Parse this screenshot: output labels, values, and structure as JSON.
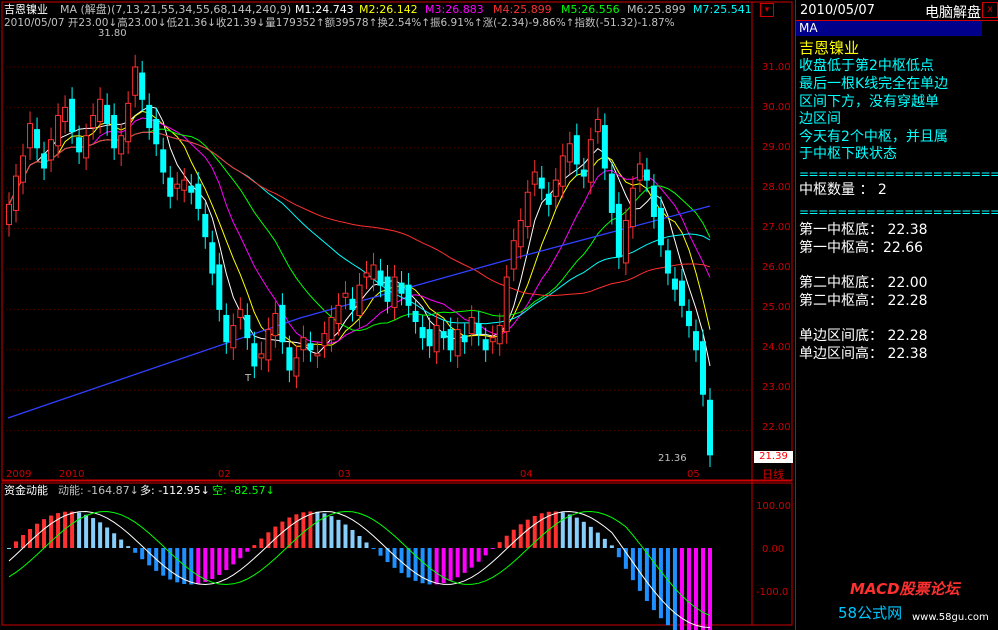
{
  "header": {
    "stock_name": "吉恩镍业",
    "ma_label": "MA (解盘)(7,13,21,55,34,55,68,144,240,9)",
    "m1": "M1:24.743",
    "m2": "M2:26.142",
    "m3": "M3:26.883",
    "m4": "M4:25.899",
    "m5": "M5:26.556",
    "m6": "M6:25.899",
    "m7": "M7:25.541",
    "quote": "2010/05/07 开23.00↓高23.00↓低21.36↓收21.39↓量179352↑额39578↑换2.54%↑振6.91%↑涨(-2.34)-9.86%↑指数(-51.32)-1.87%"
  },
  "price_axis": [
    "31.00",
    "30.00",
    "29.00",
    "28.00",
    "27.00",
    "26.00",
    "25.00",
    "24.00",
    "23.00",
    "22.00"
  ],
  "annotations": {
    "high": "31.80",
    "low": "21.36",
    "t_mark": "T"
  },
  "current_price": "21.39",
  "date_axis": [
    "2009",
    "2010",
    "02",
    "03",
    "04",
    "05"
  ],
  "period_label": "日线",
  "indicator": {
    "name": "资金动能",
    "dongneng": "动能: -164.87↓",
    "duo": "多: -112.95↓",
    "kong": "空: -82.57↓",
    "axis": [
      "100.00",
      "0.00",
      "-100.0"
    ]
  },
  "side": {
    "date": "2010/05/07",
    "title": "电脑解盘",
    "close_glyph": "x",
    "ma_tab": "MA",
    "stock": "吉恩镍业",
    "comment": [
      "收盘低于第2中枢低点",
      "最后一根K线完全在单边",
      "区间下方，没有穿越单",
      "边区间",
      "今天有2个中枢，并且属",
      "于中枢下跌状态"
    ],
    "separator": "========================",
    "count_label": "中枢数量 ： 2",
    "pivots": [
      "第一中枢底： 22.38",
      "第一中枢高：22.66",
      "第二中枢底： 22.00",
      "第二中枢高： 22.28",
      "单边区间底： 22.28",
      "单边区间高： 22.38"
    ]
  },
  "watermark": {
    "text1": "MACD股票论坛",
    "text2": "58公式网",
    "text3": "www.58gu.com"
  },
  "colors": {
    "up": "#ff3030",
    "down": "#00ffff",
    "grid": "#8b0000",
    "accent": "#ff0000"
  }
}
